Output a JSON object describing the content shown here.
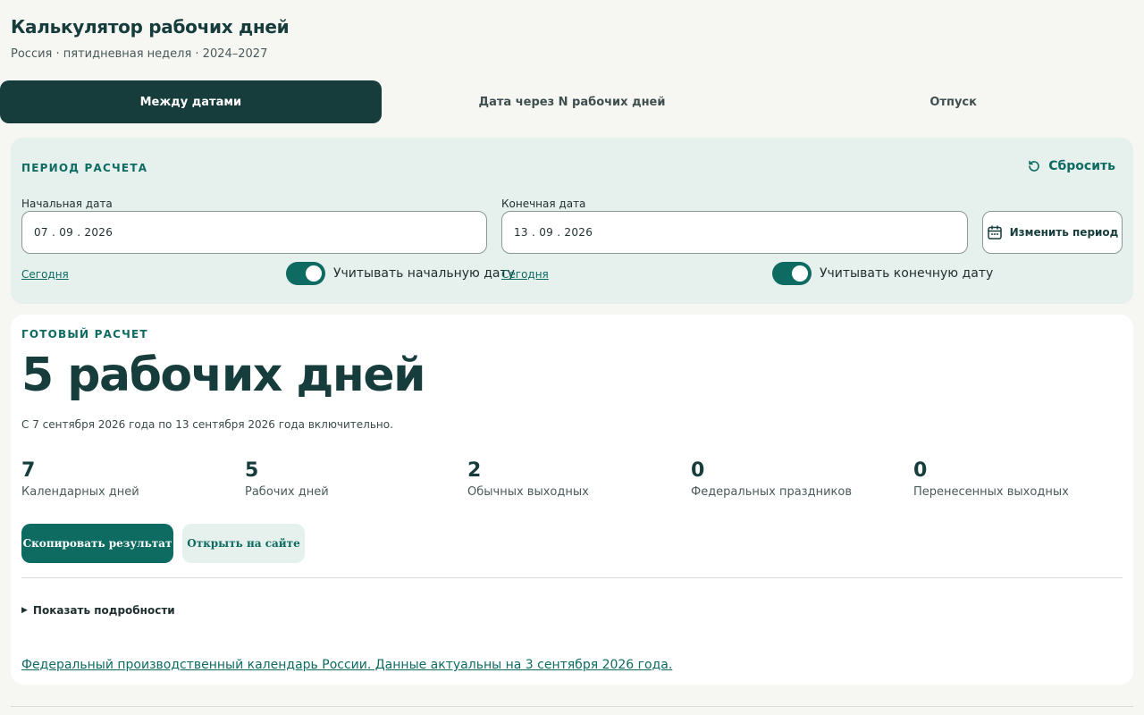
{
  "app": {
    "title": "Калькулятор рабочих дней",
    "subtitle": "Россия · пятидневная неделя · 2024–2027"
  },
  "tabs": [
    {
      "label": "Между датами",
      "active": true
    },
    {
      "label": "Дата через N рабочих дней",
      "active": false
    },
    {
      "label": "Отпуск",
      "active": false
    }
  ],
  "period": {
    "section_label": "ПЕРИОД РАСЧЕТА",
    "reset_label": "Сбросить",
    "start": {
      "label": "Начальная дата",
      "value": "07 . 09 . 2026",
      "today_link": "Сегодня",
      "toggle_label": "Учитывать начальную дату",
      "toggle_on": true
    },
    "end": {
      "label": "Конечная дата",
      "value": "13 . 09 . 2026",
      "today_link": "Сегодня",
      "toggle_label": "Учитывать конечную дату",
      "toggle_on": true
    },
    "change_period_label": "Изменить период"
  },
  "result": {
    "section_label": "ГОТОВЫЙ РАСЧЕТ",
    "headline": "5 рабочих дней",
    "description": "С 7 сентября 2026 года по 13 сентября 2026 года включительно.",
    "stats": [
      {
        "value": "7",
        "label": "Календарных дней"
      },
      {
        "value": "5",
        "label": "Рабочих дней"
      },
      {
        "value": "2",
        "label": "Обычных выходных"
      },
      {
        "value": "0",
        "label": "Федеральных праздников"
      },
      {
        "value": "0",
        "label": "Перенесенных выходных"
      }
    ],
    "copy_button": "Скопировать результат",
    "open_button": "Открыть на сайте",
    "details_toggle": "Показать подробности",
    "source_link": "Федеральный производственный календарь России. Данные актуальны на 3 сентября 2026 года."
  },
  "colors": {
    "accent": "#0d6b62",
    "dark": "#163c3c",
    "panel": "#e6f0ec",
    "background": "#f6f6f3"
  }
}
